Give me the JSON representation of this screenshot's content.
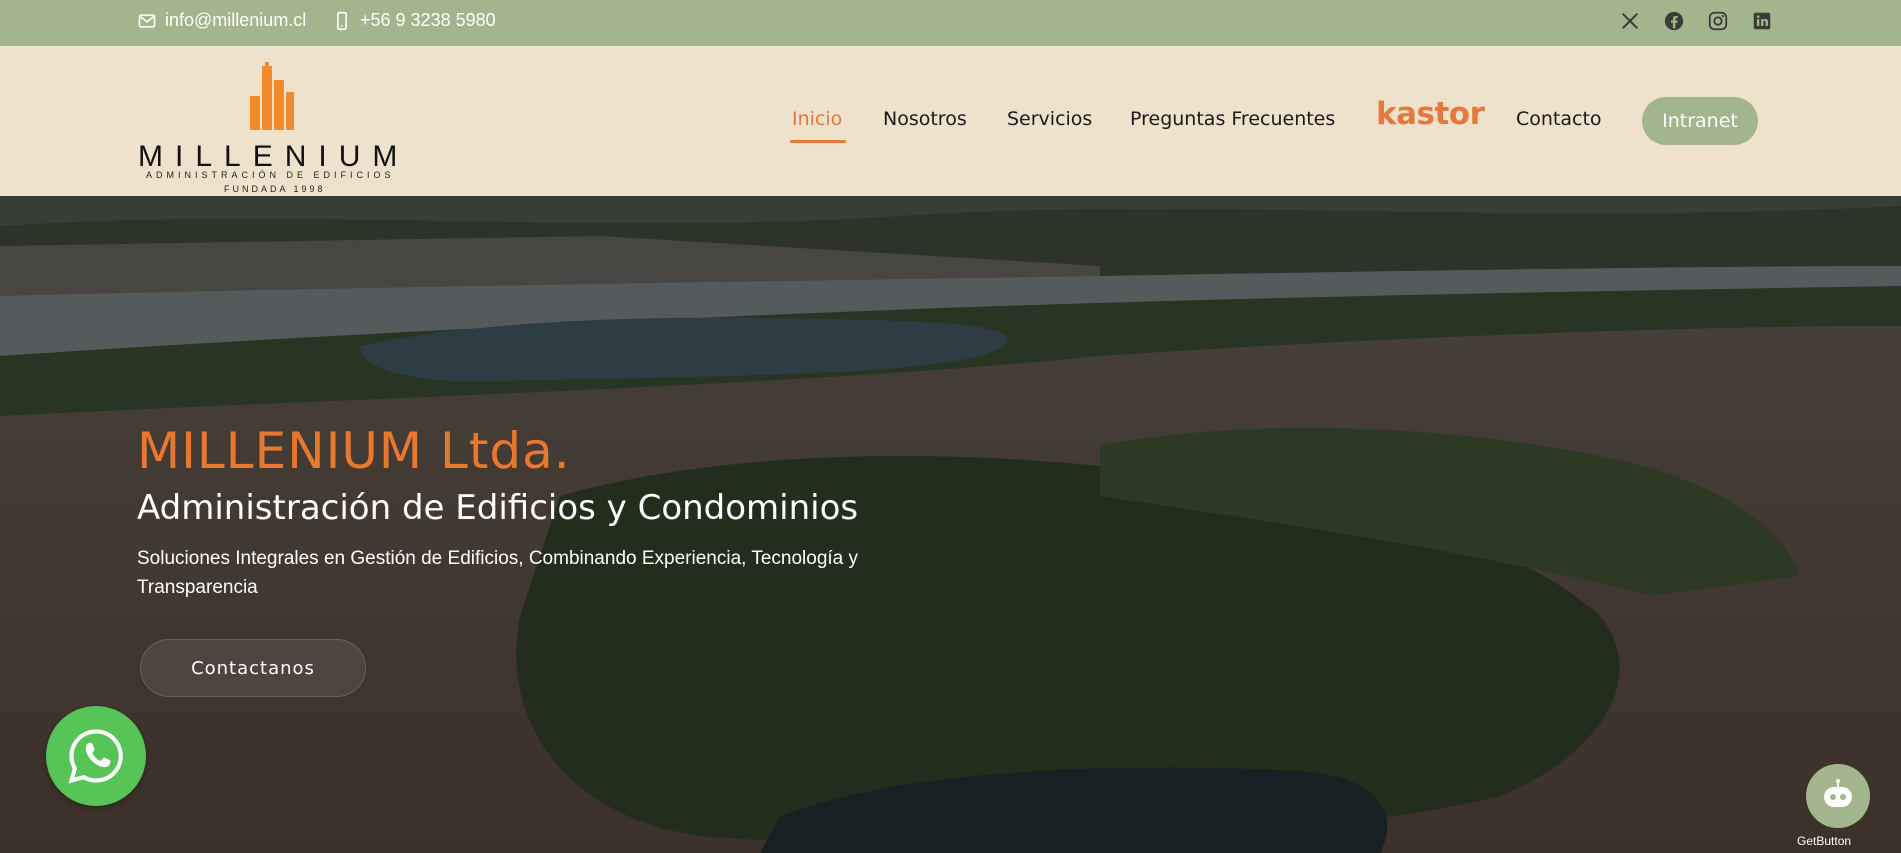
{
  "topbar": {
    "email": "info@millenium.cl",
    "phone": "+56 9 3238 5980",
    "email_icon": "envelope-icon",
    "phone_icon": "mobile-phone-icon",
    "socials": [
      "x-twitter-icon",
      "facebook-icon",
      "instagram-icon",
      "linkedin-icon"
    ]
  },
  "logo": {
    "wordmark": "MILLENIUM",
    "tagline": "ADMINISTRACIÓN DE EDIFICIOS",
    "founded": "FUNDADA 1998"
  },
  "nav": {
    "items": [
      "Inicio",
      "Nosotros",
      "Servicios",
      "Preguntas Frecuentes",
      "kastor",
      "Contacto"
    ],
    "active": "Inicio",
    "cta": "Intranet"
  },
  "hero": {
    "title": "MILLENIUM Ltda.",
    "subtitle": "Administración de Edificios y Condominios",
    "description": "Soluciones Integrales en Gestión de Edificios, Combinando Experiencia, Tecnología y Transparencia",
    "button": "Contactanos"
  },
  "widgets": {
    "whatsapp_icon": "whatsapp-icon",
    "chatbot_icon": "chatbot-icon",
    "getbutton_label": "GetButton"
  },
  "colors": {
    "topbar": "#a3b58c",
    "header_bg": "#efe2cc",
    "accent": "#e4793e",
    "intranet_button": "#a3b58c"
  }
}
